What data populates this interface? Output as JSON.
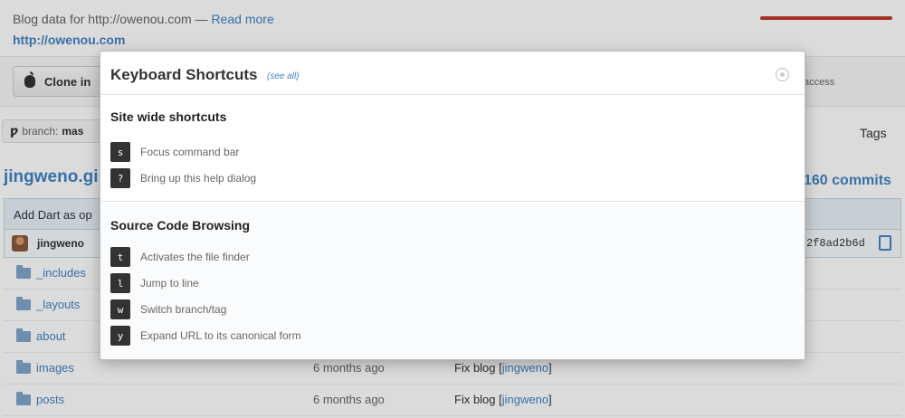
{
  "page": {
    "description_text": "Blog data for http://owenou.com — ",
    "read_more": "Read more",
    "site_link": "http://owenou.com",
    "clone_button": "Clone in",
    "access_text": "access",
    "branch_label": "branch:",
    "branch_name": "mas",
    "tags_label": "Tags",
    "repo_title": "jingweno.gi",
    "commits_count": "160 commits",
    "commit_message": "Add Dart as op",
    "commit_author": "jingweno",
    "commit_sha": "2f8ad2b6d"
  },
  "files": [
    {
      "name": "_includes",
      "age": "",
      "author": ""
    },
    {
      "name": "_layouts",
      "age": "",
      "author": ""
    },
    {
      "name": "about",
      "age": "",
      "author": ""
    },
    {
      "name": "images",
      "age": "6 months ago",
      "message": "Fix blog [",
      "author": "jingweno",
      "close": "]"
    },
    {
      "name": "posts",
      "age": "6 months ago",
      "message": "Fix blog [",
      "author": "jingweno",
      "close": "]"
    }
  ],
  "modal": {
    "title": "Keyboard Shortcuts",
    "see_all": "(see all)",
    "sections": [
      {
        "title": "Site wide shortcuts",
        "shortcuts": [
          {
            "key": "s",
            "desc": "Focus command bar"
          },
          {
            "key": "?",
            "desc": "Bring up this help dialog"
          }
        ]
      },
      {
        "title": "Source Code Browsing",
        "shortcuts": [
          {
            "key": "t",
            "desc": "Activates the file finder"
          },
          {
            "key": "l",
            "desc": "Jump to line"
          },
          {
            "key": "w",
            "desc": "Switch branch/tag"
          },
          {
            "key": "y",
            "desc": "Expand URL to its canonical form"
          }
        ]
      }
    ]
  },
  "colors": {
    "link": "#4183c4",
    "key_bg": "#333333",
    "progress": "#c0392b"
  }
}
